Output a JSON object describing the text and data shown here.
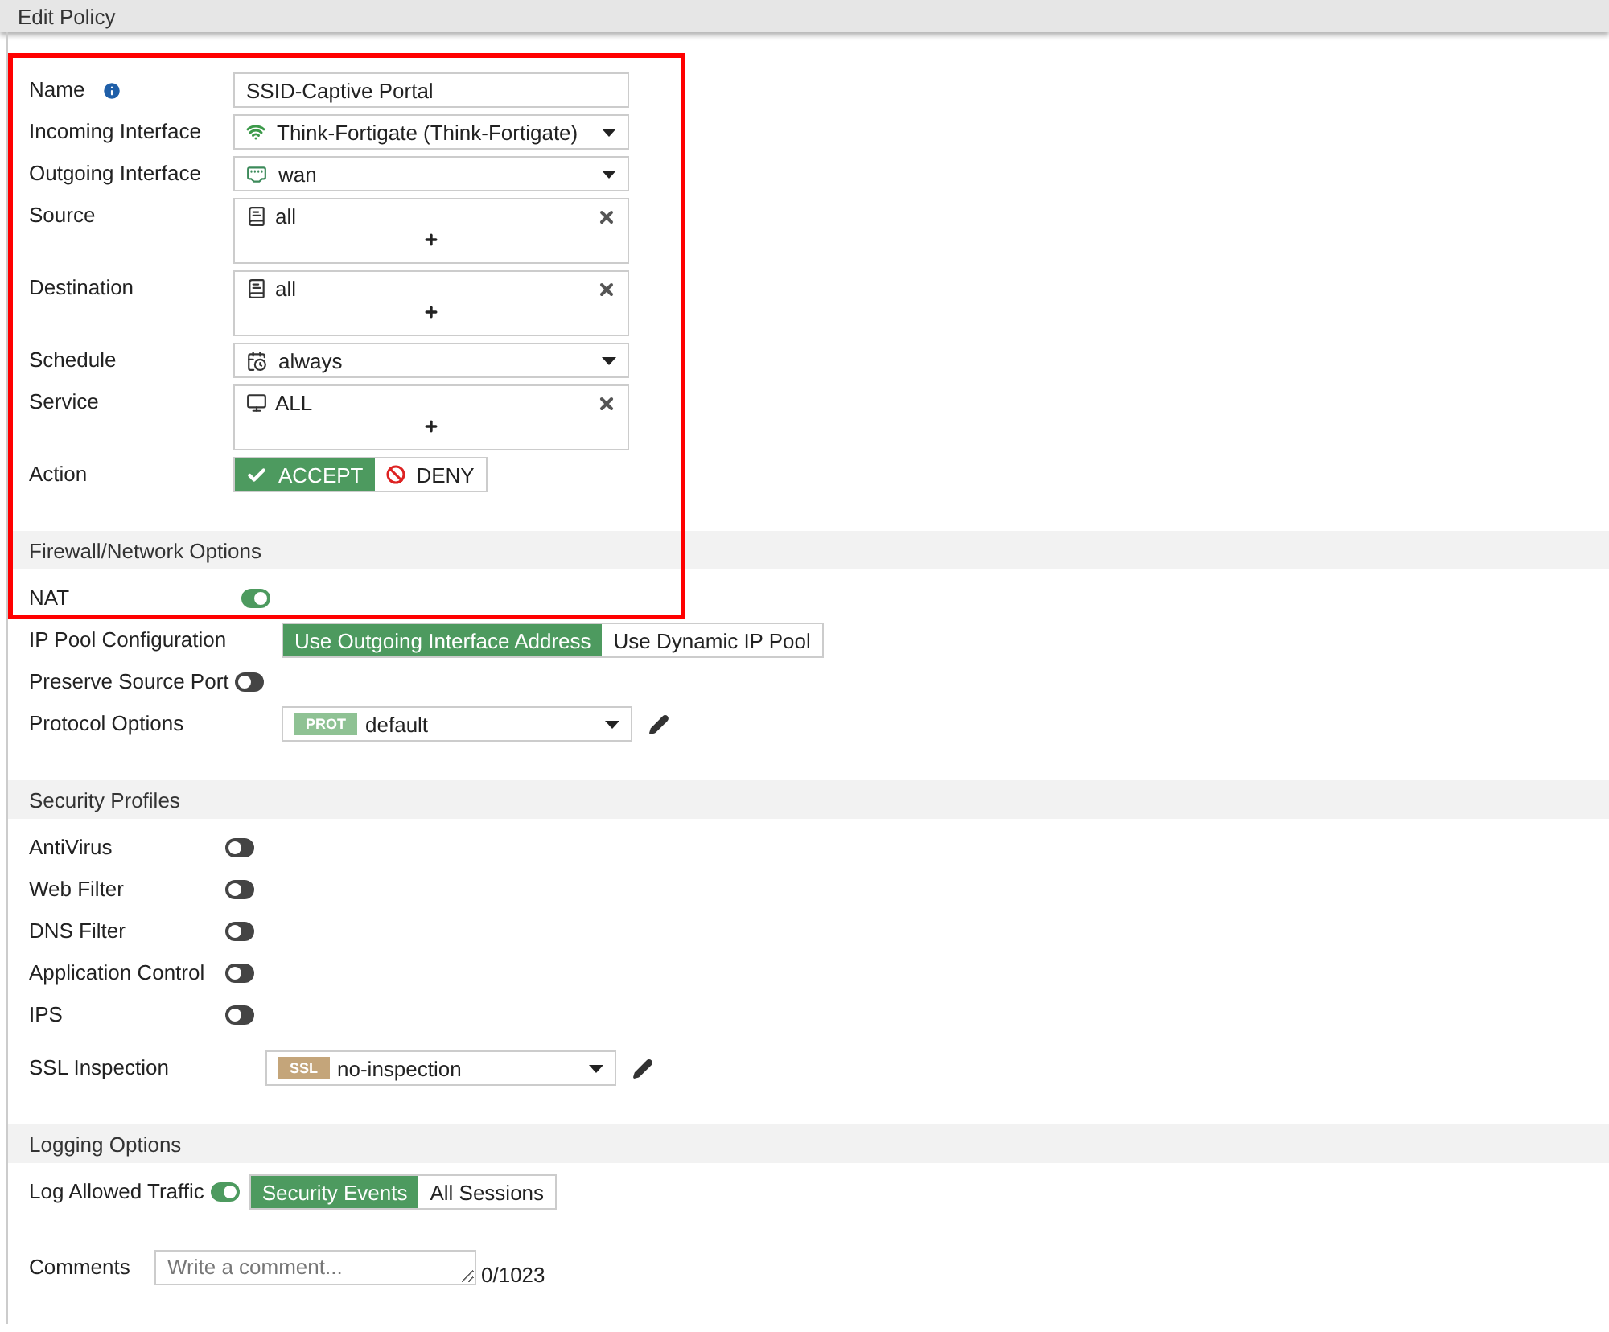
{
  "window": {
    "title": "Edit Policy"
  },
  "sections": [
    {
      "rows": [
        {
          "kind": "text",
          "label": "Name",
          "value": "SSID-Captive Portal"
        },
        {
          "kind": "select",
          "label": "Incoming Interface",
          "value": "Think-Fortigate (Think-Fortigate)"
        },
        {
          "kind": "select",
          "label": "Outgoing Interface",
          "value": "wan"
        },
        {
          "kind": "multi",
          "label": "Source",
          "value": "all"
        },
        {
          "kind": "multi",
          "label": "Destination",
          "value": "all"
        },
        {
          "kind": "select",
          "label": "Schedule",
          "value": "always"
        },
        {
          "kind": "multi",
          "label": "Service",
          "value": "ALL"
        },
        {
          "kind": "segmented",
          "label": "Action",
          "options": [
            {
              "label": "ACCEPT",
              "selected": true
            },
            {
              "label": "DENY",
              "selected": false
            }
          ]
        }
      ]
    },
    {
      "title": "Firewall/Network Options",
      "rows": [
        {
          "kind": "toggle",
          "label": "NAT",
          "on": true
        },
        {
          "kind": "segmented",
          "label": "IP Pool Configuration",
          "options": [
            {
              "label": "Use Outgoing Interface Address",
              "selected": true
            },
            {
              "label": "Use Dynamic IP Pool",
              "selected": false
            }
          ]
        },
        {
          "kind": "toggle",
          "label": "Preserve Source Port",
          "on": false
        },
        {
          "kind": "profile",
          "label": "Protocol Options",
          "tag": {
            "text": "PROT",
            "color": "#8fc294"
          },
          "value": "default"
        }
      ]
    },
    {
      "title": "Security Profiles",
      "rows": [
        {
          "kind": "toggle",
          "label": "AntiVirus",
          "on": false
        },
        {
          "kind": "toggle",
          "label": "Web Filter",
          "on": false
        },
        {
          "kind": "toggle",
          "label": "DNS Filter",
          "on": false
        },
        {
          "kind": "toggle",
          "label": "Application Control",
          "on": false
        },
        {
          "kind": "toggle",
          "label": "IPS",
          "on": false
        },
        {
          "kind": "profile",
          "label": "SSL Inspection",
          "tag": {
            "text": "SSL",
            "color": "#c4a57a"
          },
          "value": "no-inspection"
        }
      ]
    },
    {
      "title": "Logging Options",
      "rows": [
        {
          "kind": "toggle-segmented",
          "label": "Log Allowed Traffic",
          "on": true,
          "options": [
            {
              "label": "Security Events",
              "selected": true
            },
            {
              "label": "All Sessions",
              "selected": false
            }
          ]
        },
        {
          "kind": "comment",
          "label": "Comments",
          "placeholder": "Write a comment...",
          "counter": "0/1023"
        }
      ]
    }
  ]
}
